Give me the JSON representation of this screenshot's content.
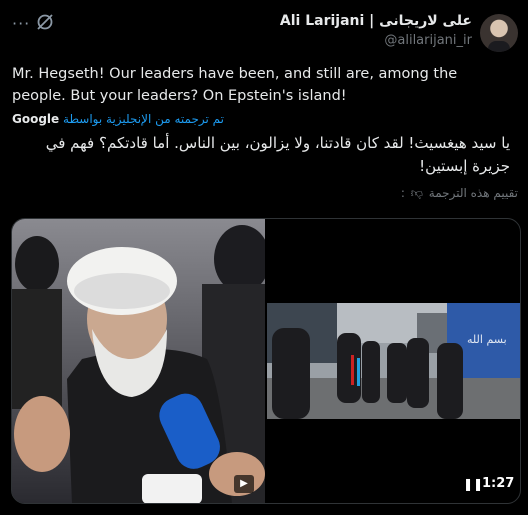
{
  "header": {
    "display_name": "Ali Larijani | علی لاریجانی",
    "handle": "@alilarijani_ir",
    "menu": "···"
  },
  "post": {
    "text": "Mr. Hegseth! Our leaders have been, and still are, among the people. But your leaders? On Epstein's island!",
    "translated_by_google": "Google",
    "translated_by_text": "تم ترجمته من الإنجليزية بواسطة",
    "translated_text": "يا سيد هيغسيث! لقد كان قادتنا، ولا يزالون، بين الناس. أما قادتكم؟ فهم في جزيرة إبستين!",
    "rate_translation": "تقييم هذه الترجمة",
    "rate_suffix": ":"
  },
  "video": {
    "timecode": "1:27",
    "pause_icon": "pause-icon",
    "play_icon": "play-icon"
  },
  "colors": {
    "background": "#000000",
    "link": "#1d9bf0",
    "muted": "#71767b"
  }
}
